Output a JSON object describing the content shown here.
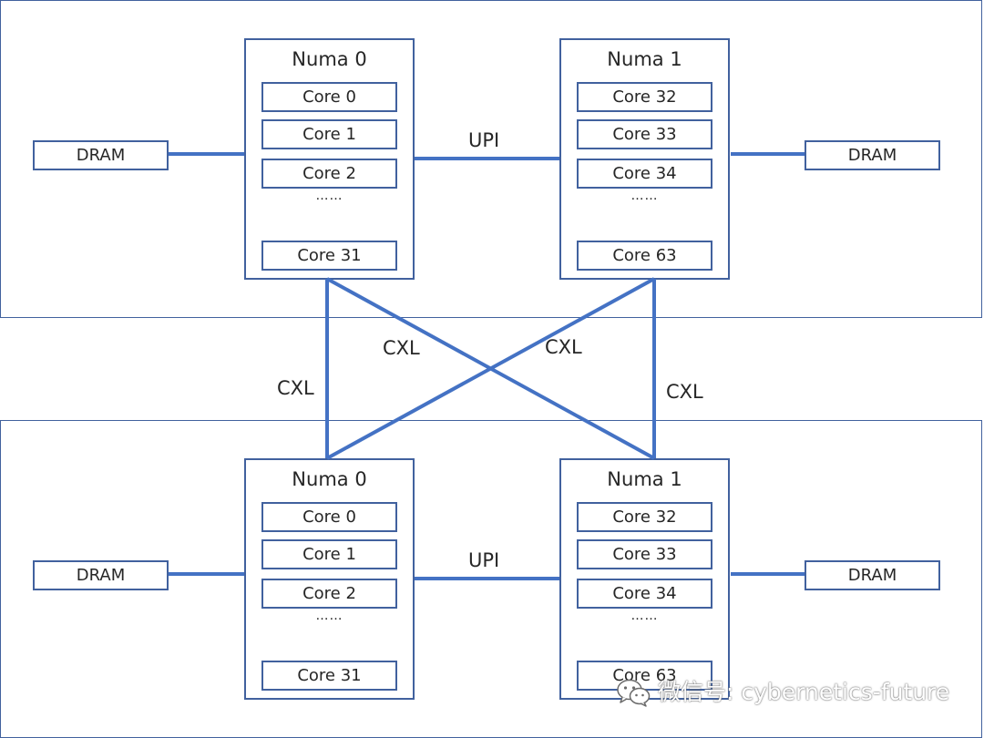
{
  "servers": [
    {
      "numa0": {
        "title": "Numa 0",
        "cores": [
          "Core 0",
          "Core 1",
          "Core 2"
        ],
        "ellipsis": "……",
        "last_core": "Core 31"
      },
      "numa1": {
        "title": "Numa 1",
        "cores": [
          "Core 32",
          "Core 33",
          "Core 34"
        ],
        "ellipsis": "……",
        "last_core": "Core 63"
      },
      "dram_left": "DRAM",
      "dram_right": "DRAM",
      "upi_label": "UPI"
    },
    {
      "numa0": {
        "title": "Numa 0",
        "cores": [
          "Core 0",
          "Core 1",
          "Core 2"
        ],
        "ellipsis": "……",
        "last_core": "Core 31"
      },
      "numa1": {
        "title": "Numa 1",
        "cores": [
          "Core 32",
          "Core 33",
          "Core 34"
        ],
        "ellipsis": "……",
        "last_core": "Core 63"
      },
      "dram_left": "DRAM",
      "dram_right": "DRAM",
      "upi_label": "UPI"
    }
  ],
  "cxl_links": {
    "left_vertical": "CXL",
    "diag_down": "CXL",
    "diag_up": "CXL",
    "right_vertical": "CXL"
  },
  "watermark": {
    "text": "微信号: cybernetics-future",
    "icon": "wechat-icon"
  },
  "colors": {
    "border": "#41619e",
    "link": "#4472c4",
    "text": "#262626"
  }
}
